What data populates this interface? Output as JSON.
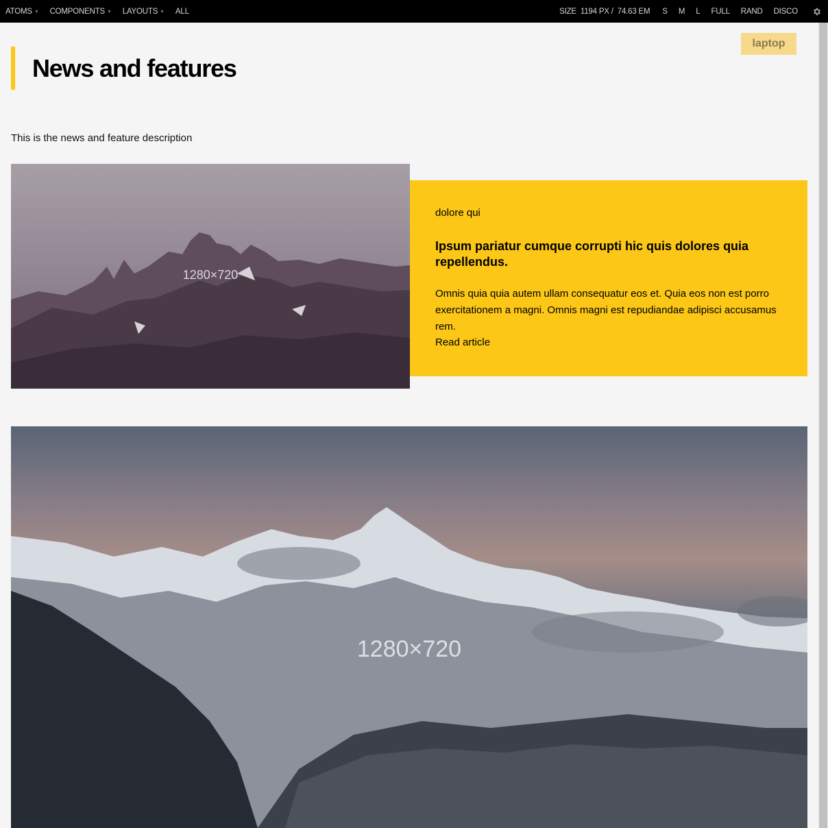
{
  "toolbar": {
    "nav": [
      {
        "label": "ATOMS",
        "dropdown": true
      },
      {
        "label": "COMPONENTS",
        "dropdown": true
      },
      {
        "label": "LAYOUTS",
        "dropdown": true
      },
      {
        "label": "ALL",
        "dropdown": false
      }
    ],
    "size_label": "SIZE",
    "size_px": "1194 PX /",
    "size_em": "74.63 EM",
    "buttons": [
      "S",
      "M",
      "L",
      "FULL",
      "RAND",
      "DISCO"
    ],
    "settings_icon": "gear-icon"
  },
  "badge": "laptop",
  "page": {
    "title": "News and features",
    "description": "This is the news and feature description"
  },
  "feature": {
    "image_label": "1280×720",
    "eyebrow": "dolore qui",
    "title": "Ipsum pariatur cumque corrupti hic quis dolores quia repellendus.",
    "body": "Omnis quia quia autem ullam consequatur eos et. Quia eos non est porro exercitationem a magni. Omnis magni est repudiandae adipisci accusamus rem.",
    "link": "Read article"
  },
  "hero": {
    "image_label": "1280×720"
  },
  "colors": {
    "accent": "#fcc716",
    "toolbar_bg": "#000000",
    "page_bg": "#f5f5f5"
  }
}
